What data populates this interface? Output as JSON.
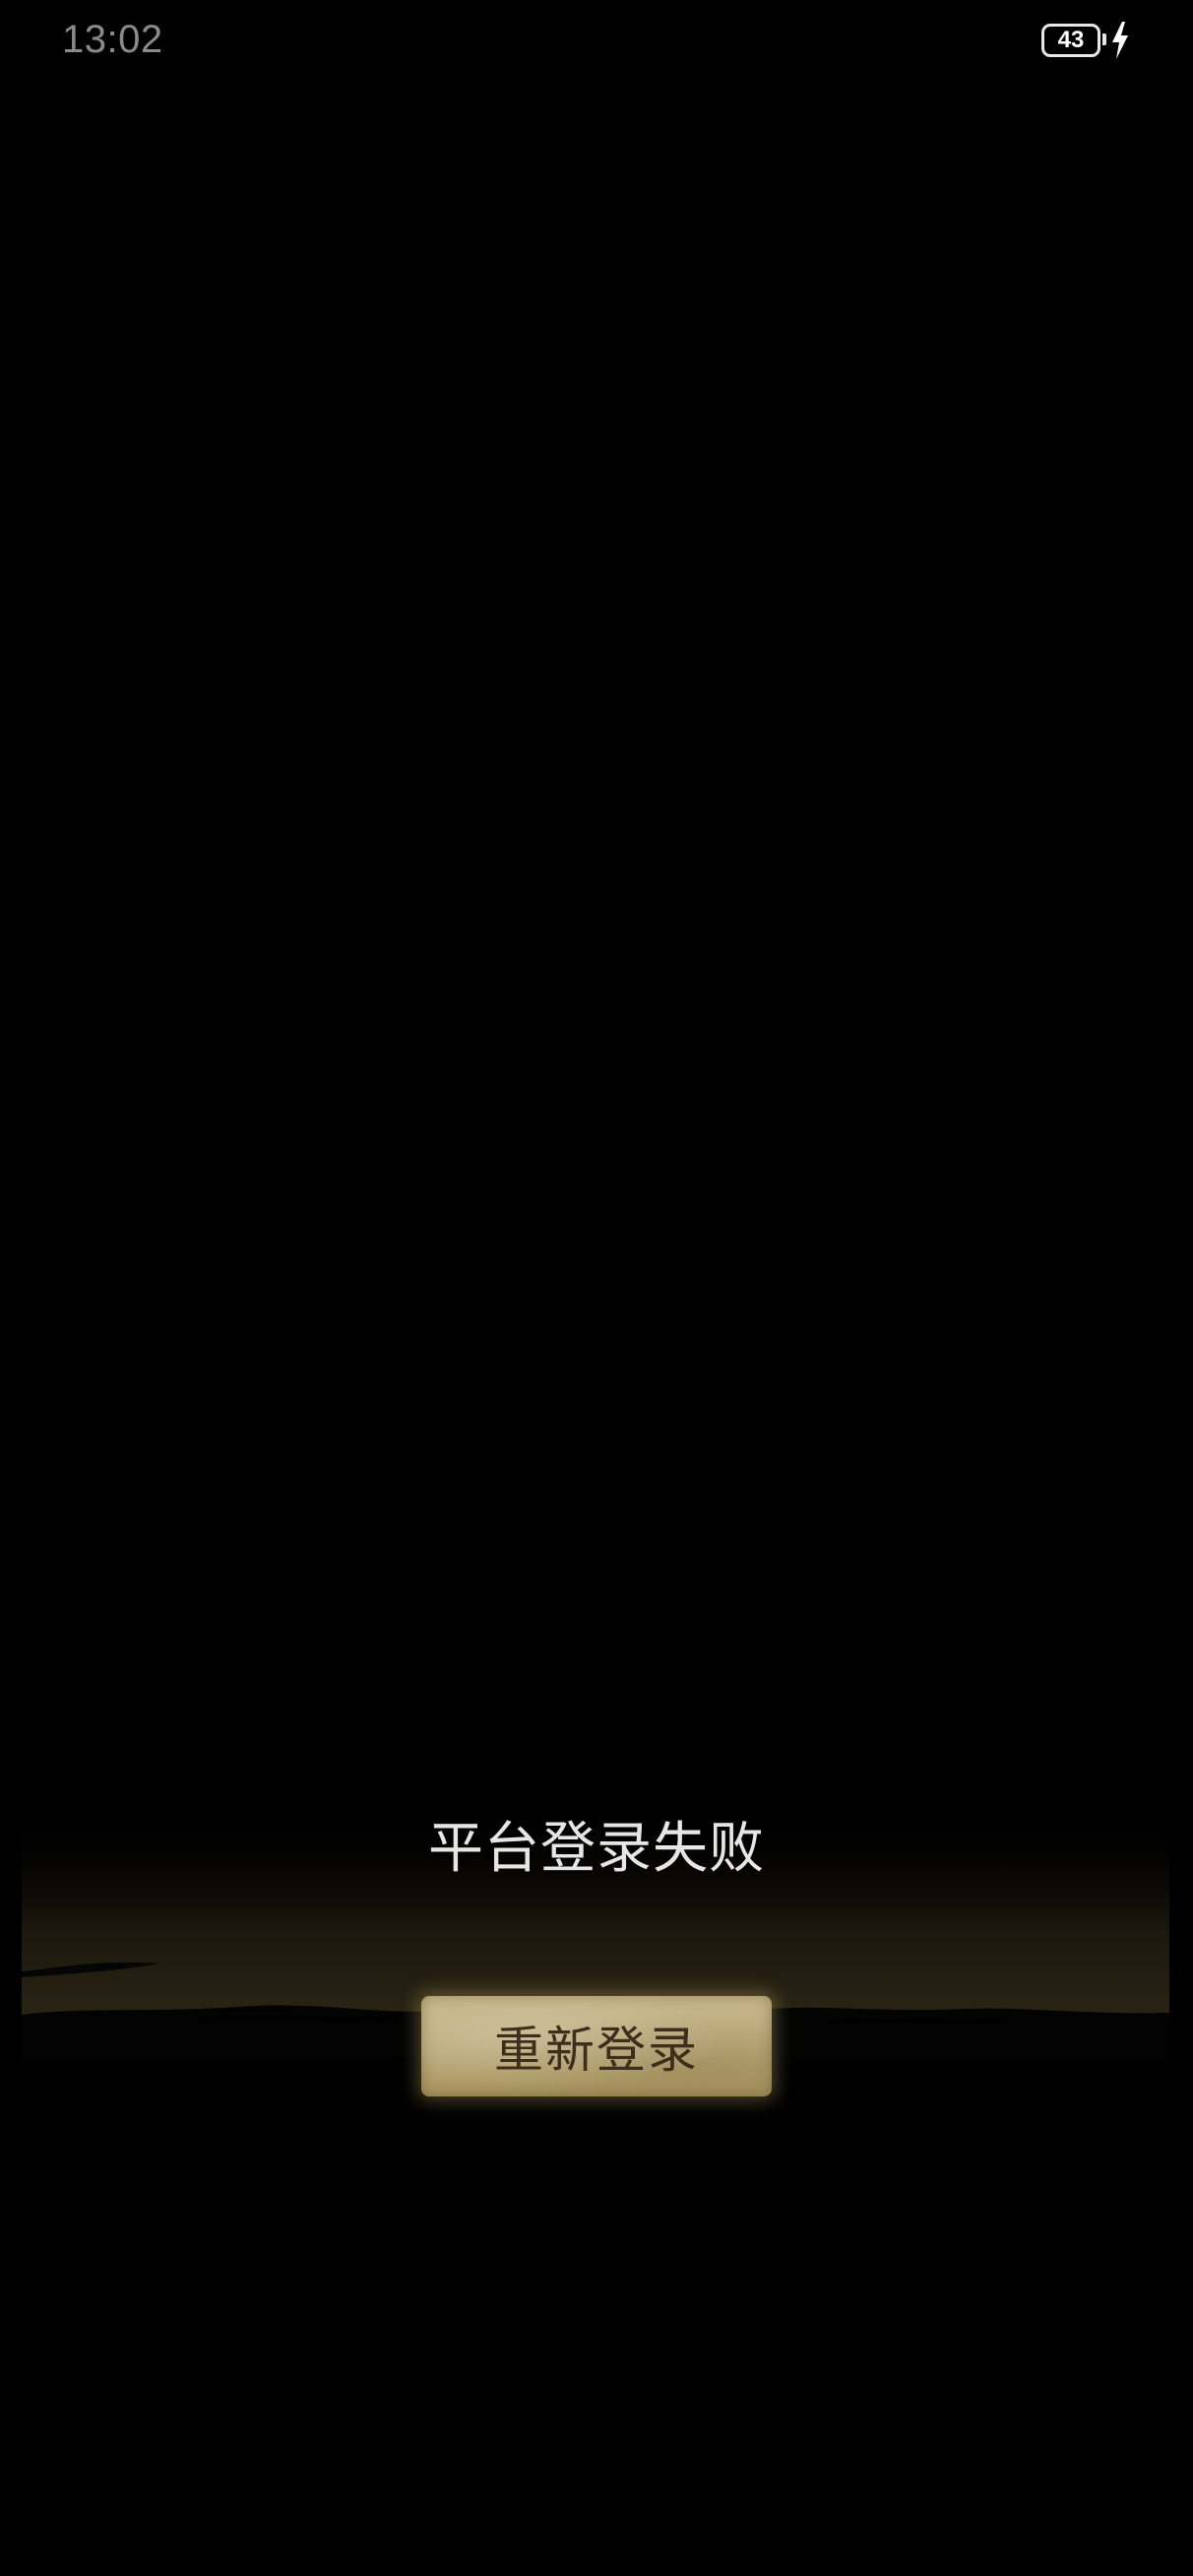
{
  "status_bar": {
    "time": "13:02",
    "battery_level": "43",
    "charging_icon": "lightning-bolt-icon"
  },
  "dialog": {
    "message": "平台登录失败",
    "relogin_button_label": "重新登录"
  },
  "colors": {
    "background": "#000000",
    "message_text": "#e6e6e6",
    "button_face": "#bba979",
    "button_text": "#3d2f1c"
  }
}
